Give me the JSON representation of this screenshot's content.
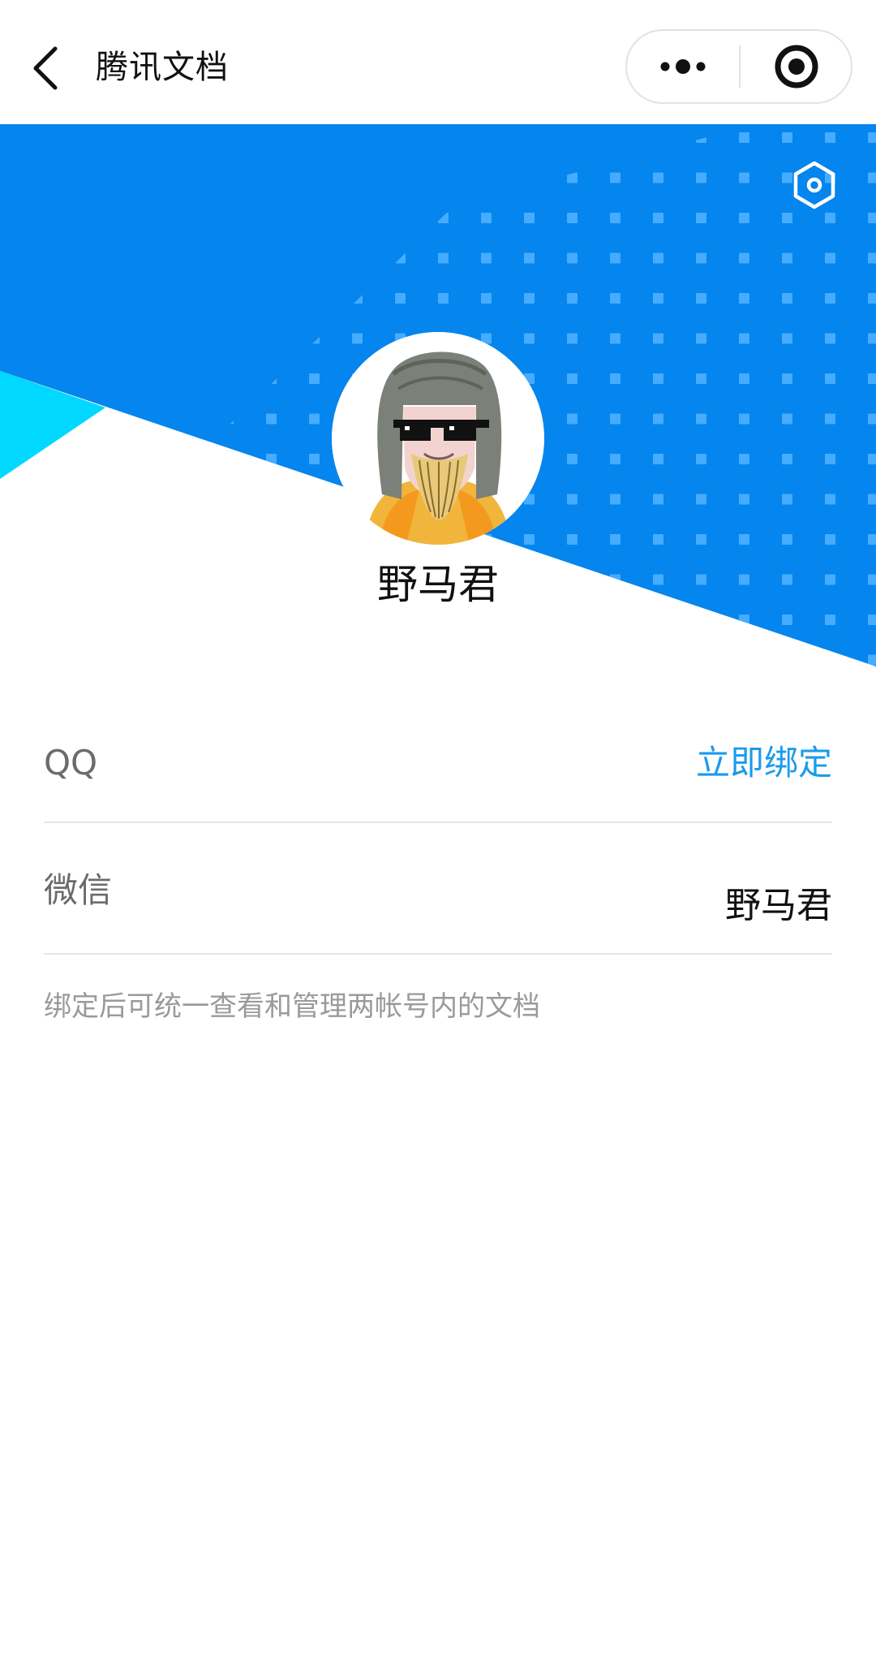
{
  "navbar": {
    "title": "腾讯文档",
    "back_icon": "chevron-left-icon",
    "more_icon": "more-dots-icon",
    "close_icon": "target-circle-icon"
  },
  "banner": {
    "colors": {
      "primary": "#0585ee",
      "dots": "#3fa9ff",
      "accent": "#00d8ff"
    },
    "settings_icon": "hexagon-settings-icon"
  },
  "profile": {
    "avatar_icon": "cartoon-avatar-icon",
    "username": "野马君"
  },
  "accounts": {
    "qq": {
      "label": "QQ",
      "action": "立即绑定"
    },
    "wechat": {
      "label": "微信",
      "value": "野马君"
    }
  },
  "hint": "绑定后可统一查看和管理两帐号内的文档",
  "colors": {
    "link": "#1a9bea",
    "label": "#6b6b6b",
    "hint": "#9a9a9a",
    "divider": "#e6e6e6"
  }
}
